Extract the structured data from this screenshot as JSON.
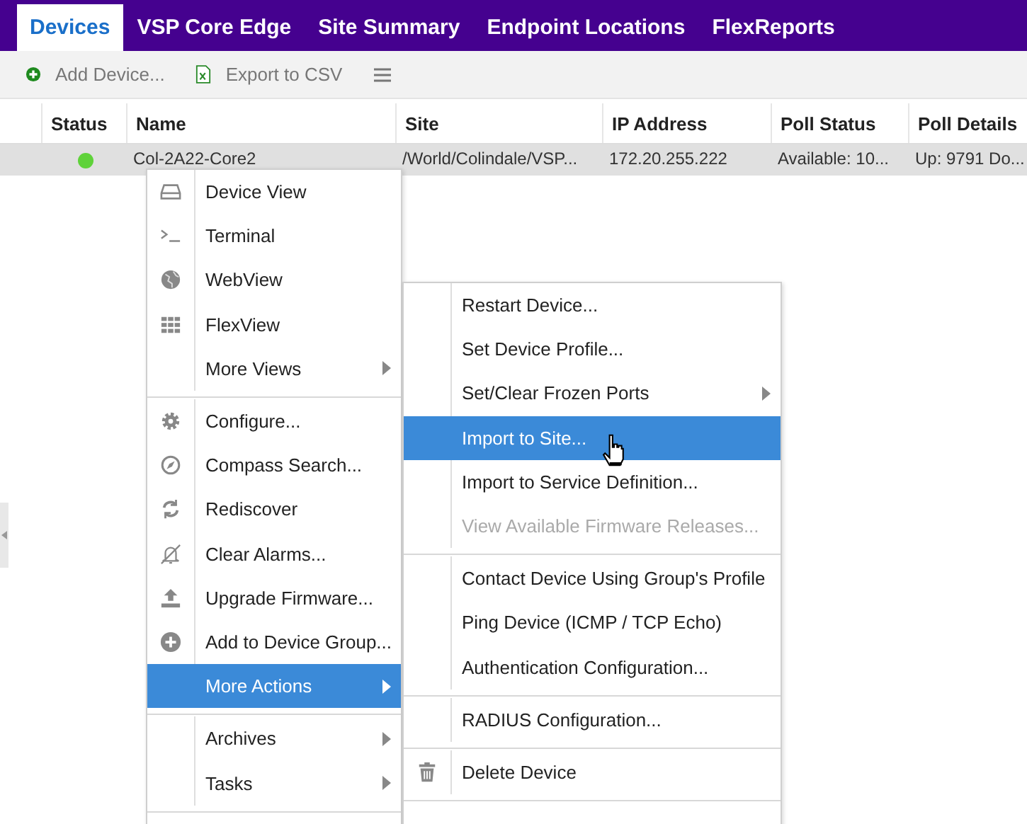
{
  "tabs": [
    {
      "label": "Devices",
      "selected": true
    },
    {
      "label": "VSP Core Edge",
      "selected": false
    },
    {
      "label": "Site Summary",
      "selected": false
    },
    {
      "label": "Endpoint Locations",
      "selected": false
    },
    {
      "label": "FlexReports",
      "selected": false
    }
  ],
  "toolbar": [
    {
      "kind": "add",
      "label": "Add Device..."
    },
    {
      "kind": "export",
      "label": "Export to CSV"
    },
    {
      "kind": "menu"
    }
  ],
  "table": {
    "columns": [
      "Status",
      "Name",
      "Site",
      "IP Address",
      "Poll Status",
      "Poll Details"
    ],
    "rows": [
      {
        "selected": true,
        "cells": [
          "",
          "Col-2A22-Core2",
          "/World/Colindale/VSP...",
          "172.20.255.222",
          "Available: 10...",
          "Up: 9791 Do..."
        ]
      }
    ]
  },
  "context_menu": {
    "groups": [
      [
        {
          "label": "Device View",
          "submenu": false,
          "selected": false
        },
        {
          "label": "Terminal",
          "submenu": false,
          "selected": false
        },
        {
          "label": "WebView",
          "submenu": false,
          "selected": false
        },
        {
          "label": "FlexView",
          "submenu": false,
          "selected": false
        },
        {
          "label": "More Views",
          "submenu": true,
          "selected": false
        }
      ],
      [
        {
          "label": "Configure...",
          "submenu": false,
          "selected": false
        },
        {
          "label": "Compass Search...",
          "submenu": false,
          "selected": false
        },
        {
          "label": "Rediscover",
          "submenu": false,
          "selected": false
        },
        {
          "label": "Clear Alarms...",
          "submenu": false,
          "selected": false
        },
        {
          "label": "Upgrade Firmware...",
          "submenu": false,
          "selected": false
        },
        {
          "label": "Add to Device Group...",
          "submenu": false,
          "selected": false
        },
        {
          "label": "More Actions",
          "submenu": true,
          "selected": true
        }
      ],
      [
        {
          "label": "Archives",
          "submenu": true,
          "selected": false
        },
        {
          "label": "Tasks",
          "submenu": true,
          "selected": false
        }
      ]
    ]
  },
  "submenu": {
    "groups": [
      [
        {
          "label": "Restart Device...",
          "submenu": false,
          "selected": false,
          "disabled": false
        },
        {
          "label": "Set Device Profile...",
          "submenu": false,
          "selected": false,
          "disabled": false
        },
        {
          "label": "Set/Clear Frozen Ports",
          "submenu": true,
          "selected": false,
          "disabled": false
        },
        {
          "label": "Import to Site...",
          "submenu": false,
          "selected": true,
          "disabled": false
        },
        {
          "label": "Import to Service Definition...",
          "submenu": false,
          "selected": false,
          "disabled": false
        },
        {
          "label": "View Available Firmware Releases...",
          "submenu": false,
          "selected": false,
          "disabled": true
        }
      ],
      [
        {
          "label": "Contact Device Using Group's Profile",
          "submenu": false,
          "selected": false,
          "disabled": false
        },
        {
          "label": "Ping Device (ICMP / TCP Echo)",
          "submenu": false,
          "selected": false,
          "disabled": false
        },
        {
          "label": "Authentication Configuration...",
          "submenu": false,
          "selected": false,
          "disabled": false
        }
      ],
      [
        {
          "label": "RADIUS Configuration...",
          "submenu": false,
          "selected": false,
          "disabled": false
        }
      ],
      [
        {
          "label": "Delete Device",
          "submenu": false,
          "selected": false,
          "disabled": false
        }
      ]
    ]
  }
}
